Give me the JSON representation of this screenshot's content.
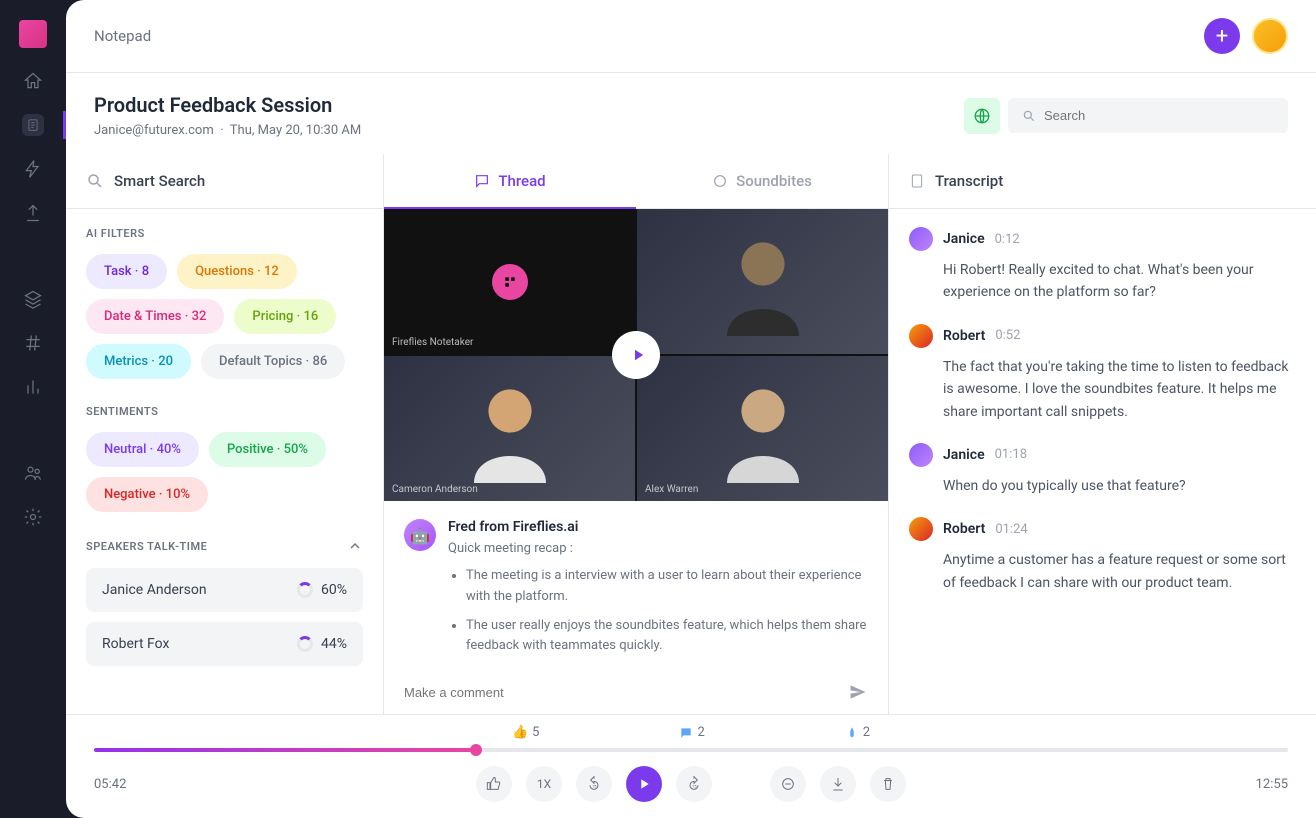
{
  "app_name": "Notepad",
  "meeting": {
    "title": "Product Feedback Session",
    "owner": "Janice@futurex.com",
    "datetime": "Thu, May 20, 10:30 AM"
  },
  "search_placeholder": "Search",
  "smart_search_label": "Smart Search",
  "ai_filters": {
    "label": "AI FILTERS",
    "items": [
      {
        "name": "Task",
        "count": 8,
        "style": "chip-task"
      },
      {
        "name": "Questions",
        "count": 12,
        "style": "chip-questions"
      },
      {
        "name": "Date & Times",
        "count": 32,
        "style": "chip-datetimes"
      },
      {
        "name": "Pricing",
        "count": 16,
        "style": "chip-pricing"
      },
      {
        "name": "Metrics",
        "count": 20,
        "style": "chip-metrics"
      },
      {
        "name": "Default Topics",
        "count": 86,
        "style": "chip-default"
      }
    ]
  },
  "sentiments": {
    "label": "SENTIMENTS",
    "items": [
      {
        "name": "Neutral",
        "pct": "40%",
        "style": "chip-neutral"
      },
      {
        "name": "Positive",
        "pct": "50%",
        "style": "chip-positive"
      },
      {
        "name": "Negative",
        "pct": "10%",
        "style": "chip-negative"
      }
    ]
  },
  "speakers": {
    "label": "SPEAKERS TALK-TIME",
    "items": [
      {
        "name": "Janice Anderson",
        "pct": "60%"
      },
      {
        "name": "Robert Fox",
        "pct": "44%"
      }
    ]
  },
  "tabs": {
    "thread": "Thread",
    "soundbites": "Soundbites"
  },
  "video_tiles": {
    "t0": "Fireflies Notetaker",
    "t2": "Cameron Anderson",
    "t3": "Alex Warren"
  },
  "bot": {
    "name": "Fred from Fireflies.ai",
    "subtitle": "Quick meeting recap :",
    "points": [
      "The meeting is a interview with a user to learn about their experience with the platform.",
      "The user really enjoys the soundbites feature, which helps them share feedback with teammates quickly."
    ]
  },
  "comment_placeholder": "Make a comment",
  "transcript": {
    "label": "Transcript",
    "entries": [
      {
        "speaker": "Janice",
        "time": "0:12",
        "avatar": "av-janice",
        "text": "Hi Robert! Really excited to chat. What's been your experience on the platform so far?"
      },
      {
        "speaker": "Robert",
        "time": "0:52",
        "avatar": "av-robert",
        "text": "The fact that you're taking the time to listen to feedback is awesome. I love the soundbites feature. It helps me share important call snippets."
      },
      {
        "speaker": "Janice",
        "time": "01:18",
        "avatar": "av-janice",
        "text": "When do you typically use that feature?"
      },
      {
        "speaker": "Robert",
        "time": "01:24",
        "avatar": "av-robert",
        "text": "Anytime a customer has a feature request or some sort of feedback I can share with our product team."
      }
    ]
  },
  "player": {
    "likes": "5",
    "comments": "2",
    "pins": "2",
    "current_time": "05:42",
    "total_time": "12:55",
    "speed": "1X"
  }
}
